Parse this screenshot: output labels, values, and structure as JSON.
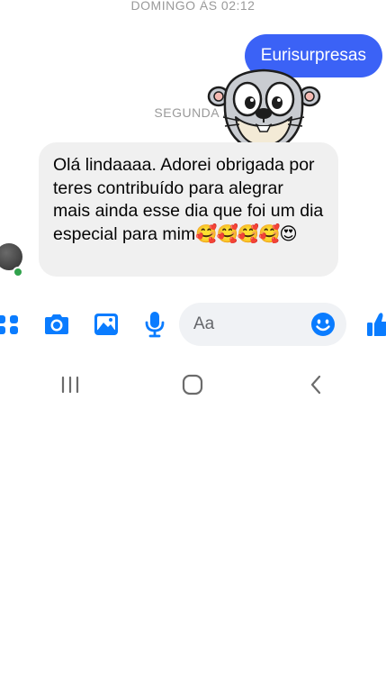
{
  "conversation": {
    "timestamp_top": "DOMINGO ÀS 02:12",
    "timestamp_mid": "SEGUNDA À",
    "outgoing_message": "Eurisurpresas",
    "incoming_message": {
      "text": "Olá lindaaaa. Adorei obrigada por teres contribuído para alegrar mais ainda esse dia que foi um dia especial para mim",
      "emojis": "🥰🥰🥰🥰😍"
    },
    "contact_status": "online"
  },
  "composer": {
    "placeholder": "Aa",
    "icons": [
      "apps-icon",
      "camera-icon",
      "gallery-icon",
      "microphone-icon",
      "emoji-icon",
      "like-icon"
    ]
  },
  "system_nav": {
    "icons": [
      "recent-apps-icon",
      "home-icon",
      "back-icon"
    ]
  },
  "colors": {
    "accent": "#0a7cff",
    "outgoing_bubble": "#3b62f6",
    "incoming_bubble": "#f0f0f0",
    "online": "#31a24c"
  }
}
